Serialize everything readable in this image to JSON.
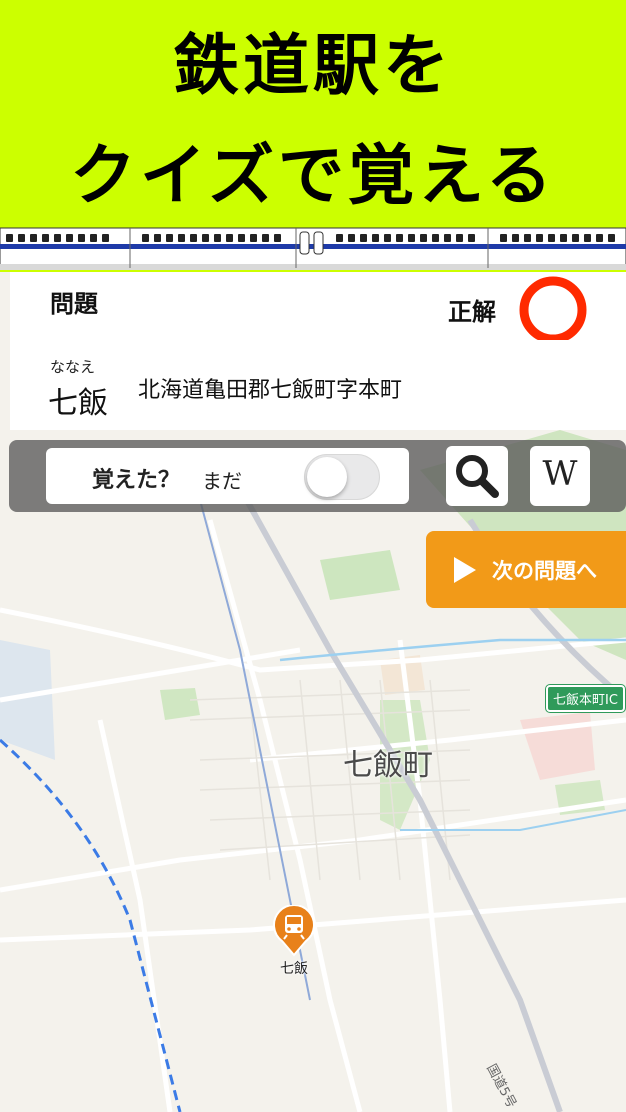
{
  "banner": {
    "line1": "鉄道駅を",
    "line2": "クイズで覚える"
  },
  "question": {
    "label": "問題",
    "answer_label": "正解",
    "answer_mark": "circle-correct",
    "furigana": "ななえ",
    "station_name": "七飯",
    "address": "北海道亀田郡七飯町字本町"
  },
  "controls": {
    "memorized_label": "覚えた？",
    "memorized_state": "まだ",
    "toggle_on": false,
    "search_icon": "search-icon",
    "wiki_label": "W"
  },
  "next_button": {
    "label": "次の問題へ"
  },
  "map": {
    "town_label": "七飯町",
    "ic_label": "七飯本町IC",
    "station_pin_label": "七飯",
    "route_label": "国道5号"
  },
  "colors": {
    "banner_bg": "#ccff00",
    "next_button_bg": "#f29a18",
    "correct_mark": "#ff2a00",
    "ic_badge": "#2f9a5a"
  }
}
